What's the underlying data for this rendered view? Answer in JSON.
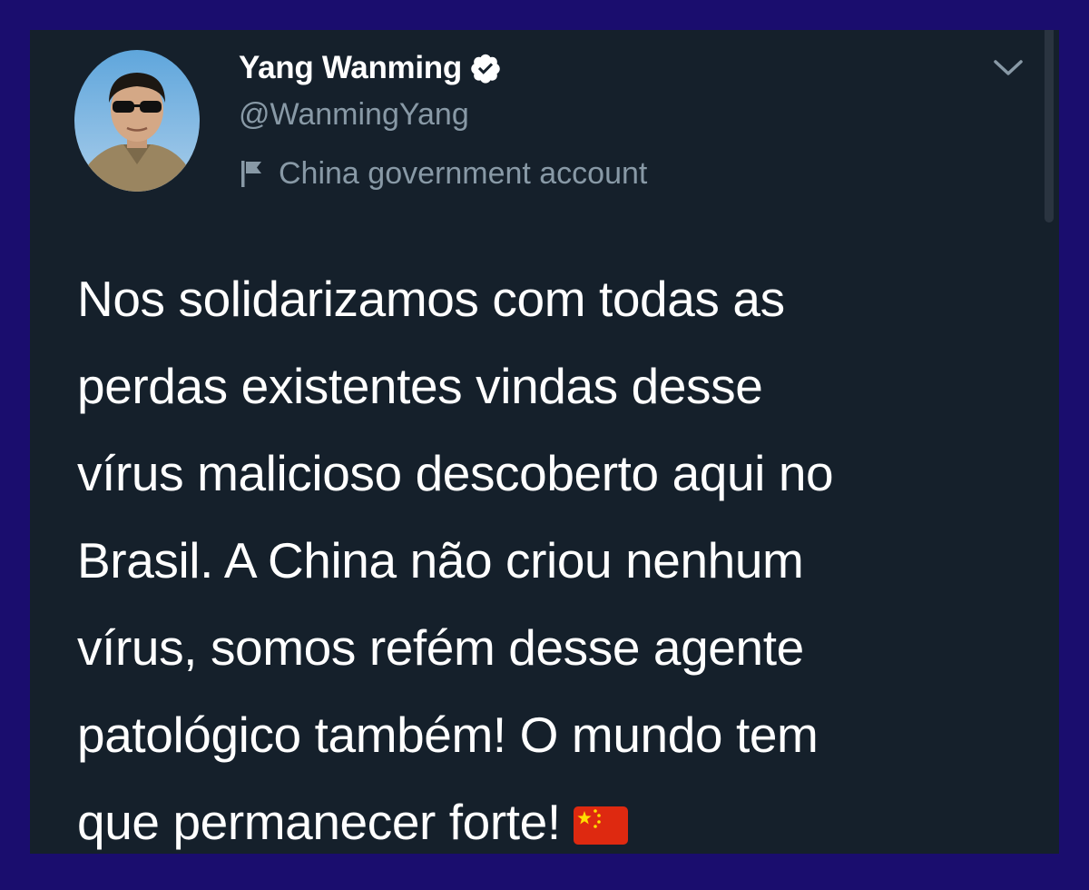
{
  "tweet": {
    "author": {
      "display_name": "Yang Wanming",
      "handle": "@WanmingYang",
      "verified": true,
      "government_label": "China government account"
    },
    "text_lines": [
      "Nos solidarizamos com todas as",
      "perdas existentes vindas desse",
      "vírus malicioso descoberto aqui no",
      "Brasil. A China não criou nenhum",
      "vírus, somos refém desse agente",
      "patológico também! O mundo tem",
      "que permanecer forte!"
    ],
    "trailing_emoji": "china-flag",
    "icons": {
      "verified": "verified-badge-icon",
      "gov_flag": "flag-outline-icon",
      "menu": "chevron-down-icon"
    }
  },
  "colors": {
    "frame": "#1a0d6e",
    "card_background": "#15202b",
    "primary_text": "#ffffff",
    "secondary_text": "#8899a6"
  }
}
